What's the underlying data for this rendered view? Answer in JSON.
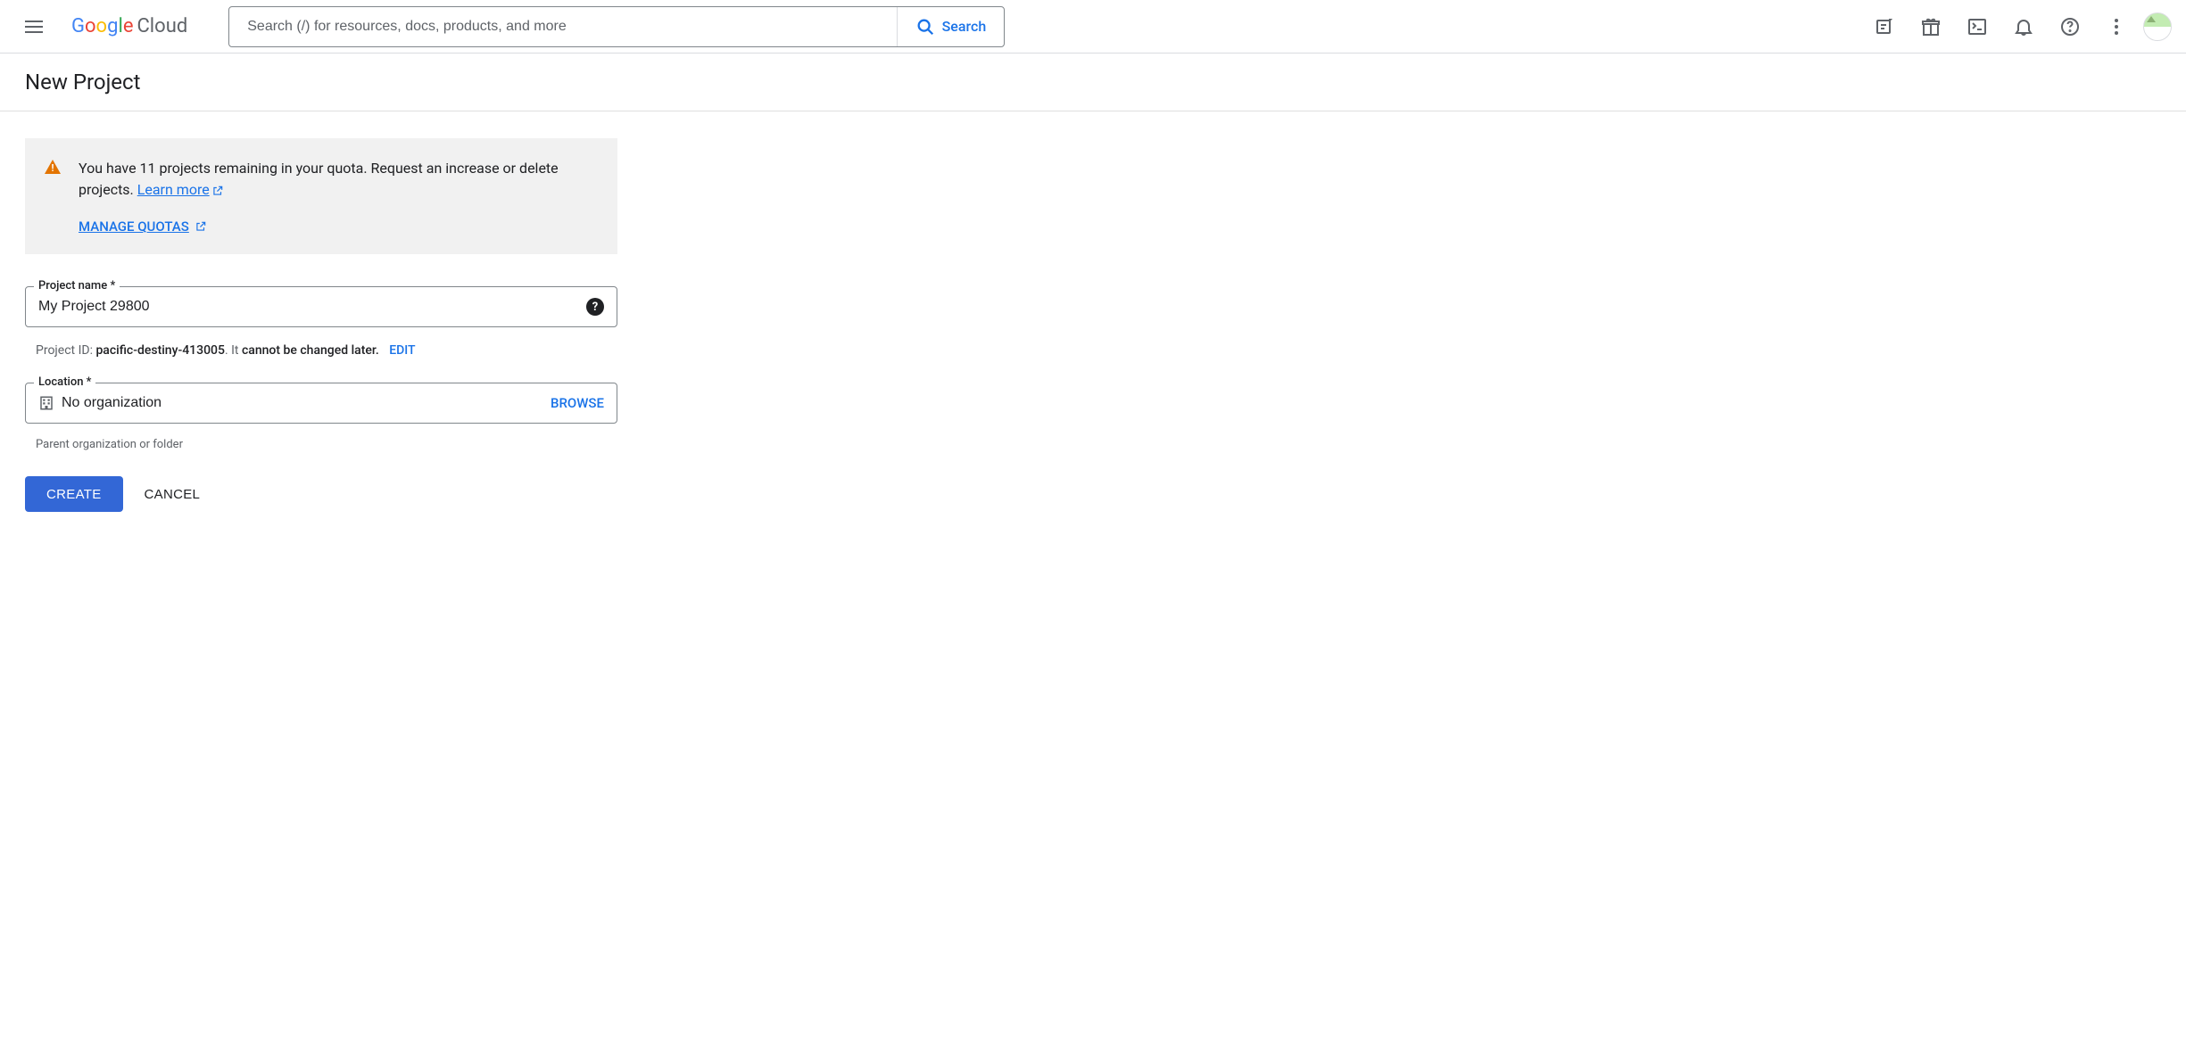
{
  "header": {
    "logo_google": "Google",
    "logo_cloud": "Cloud",
    "search_placeholder": "Search (/) for resources, docs, products, and more",
    "search_button": "Search"
  },
  "page": {
    "title": "New Project"
  },
  "quota": {
    "message_part1": "You have 11 projects remaining in your quota. Request an increase or delete projects. ",
    "learn_more": "Learn more",
    "manage_quotas": "MANAGE QUOTAS"
  },
  "form": {
    "project_name_label": "Project name *",
    "project_name_value": "My Project 29800",
    "project_id_prefix": "Project ID: ",
    "project_id_value": "pacific-destiny-413005",
    "project_id_suffix1": ". It ",
    "project_id_suffix2": "cannot be changed later.",
    "edit_label": "EDIT",
    "location_label": "Location *",
    "location_value": "No organization",
    "browse_label": "BROWSE",
    "location_helper": "Parent organization or folder"
  },
  "actions": {
    "create": "CREATE",
    "cancel": "CANCEL"
  }
}
